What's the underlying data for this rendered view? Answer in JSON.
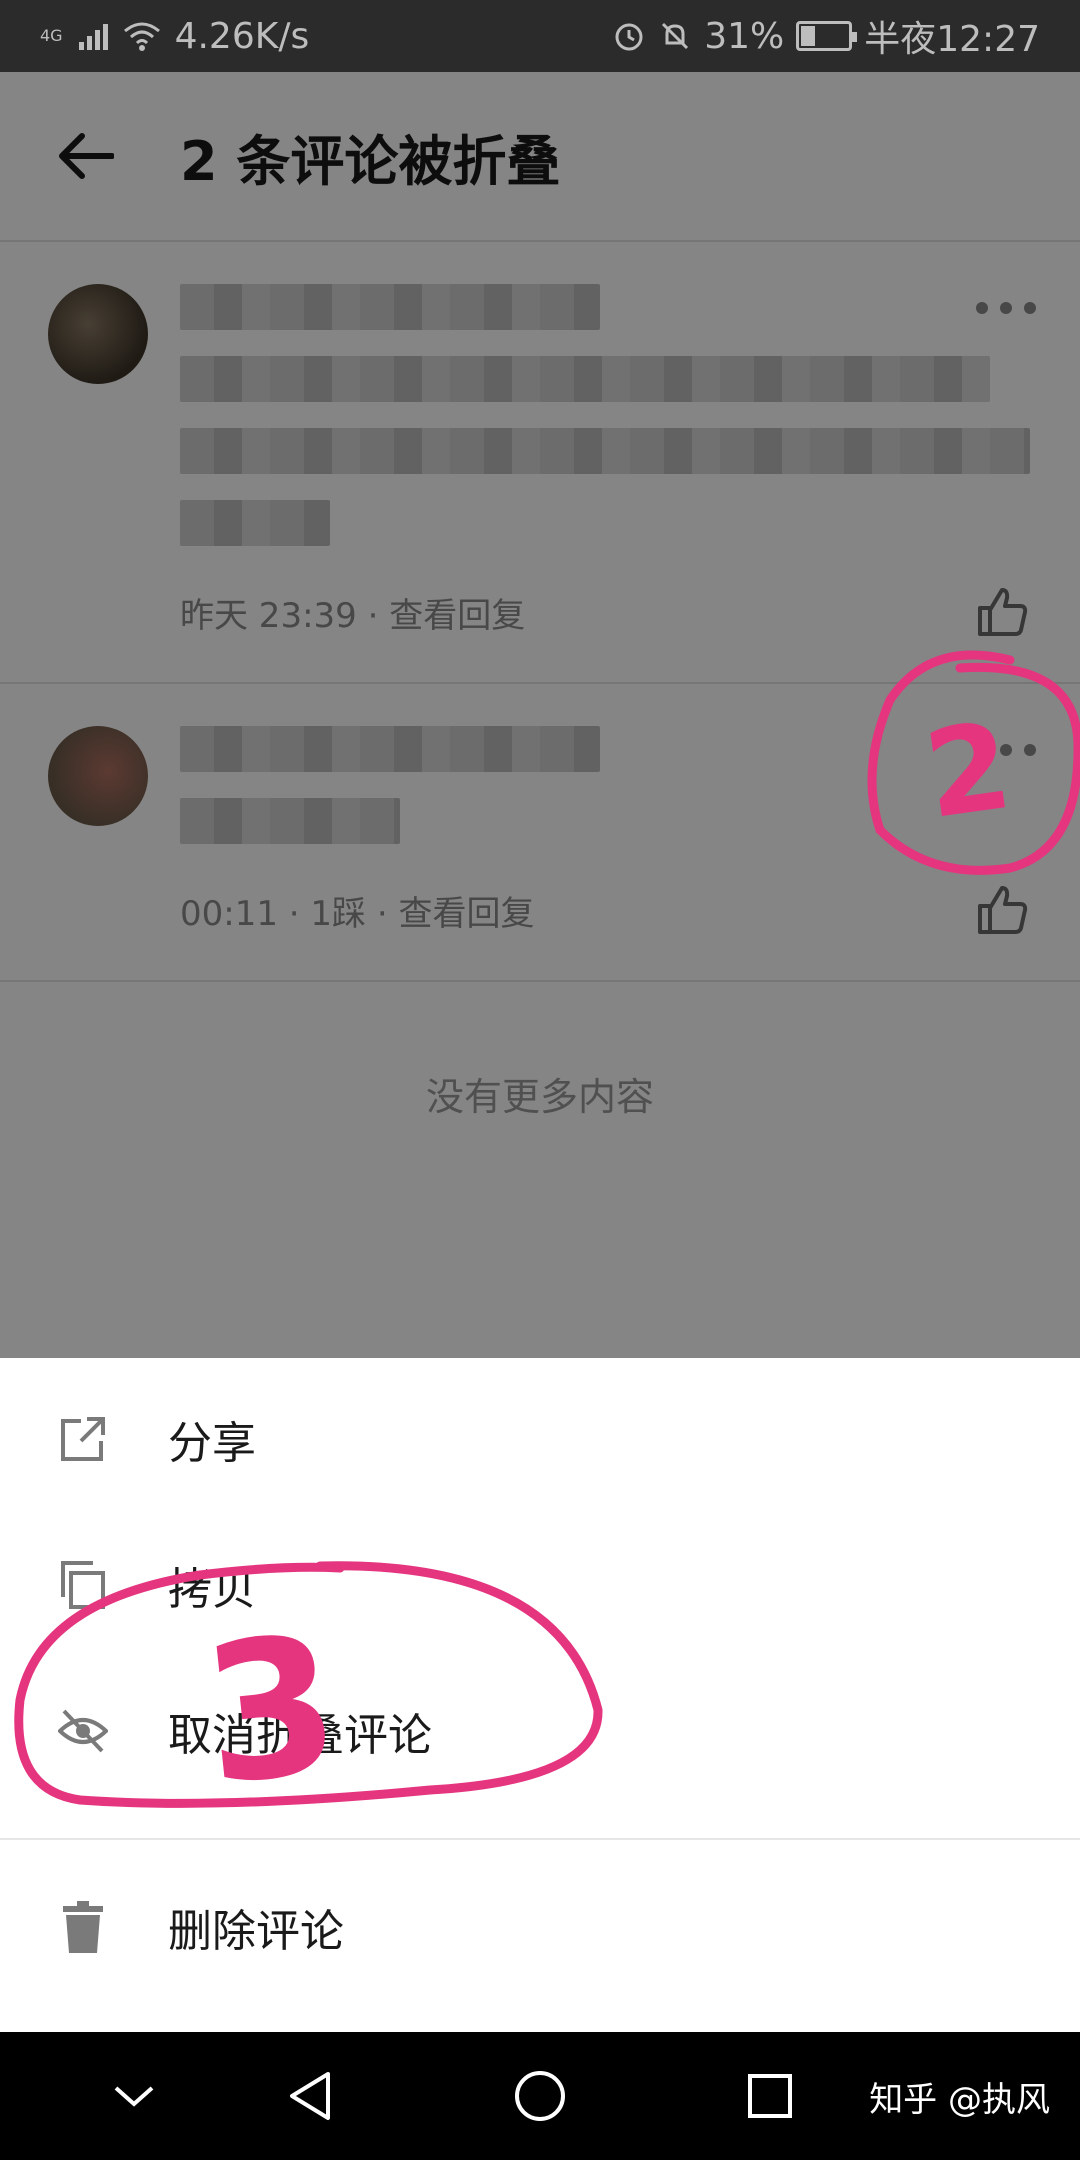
{
  "status_bar": {
    "network_type": "4G",
    "net_speed": "4.26K/s",
    "battery_text": "31%",
    "battery_level": 0.31,
    "time": "半夜12:27",
    "icons": [
      "signal-icon",
      "wifi-icon",
      "alarm-icon",
      "bell-off-icon",
      "battery-icon"
    ]
  },
  "header": {
    "title": "2 条评论被折叠"
  },
  "comments": [
    {
      "meta": "昨天 23:39 · 查看回复"
    },
    {
      "meta": "00:11 · 1踩 · 查看回复"
    }
  ],
  "list_end_text": "没有更多内容",
  "sheet": {
    "items": [
      {
        "label": "分享",
        "icon": "share-icon"
      },
      {
        "label": "拷贝",
        "icon": "copy-icon"
      },
      {
        "label": "取消折叠评论",
        "icon": "eye-off-icon"
      },
      {
        "label": "删除评论",
        "icon": "trash-icon"
      }
    ]
  },
  "annotations": {
    "marker_2": "2",
    "marker_3": "3",
    "color": "#e5357f"
  },
  "nav": {
    "watermark": "知乎 @执风"
  },
  "colors": {
    "dim_overlay": "rgba(0,0,0,0.48)",
    "status_bg": "#2b2b2b",
    "nav_bg": "#000000"
  }
}
